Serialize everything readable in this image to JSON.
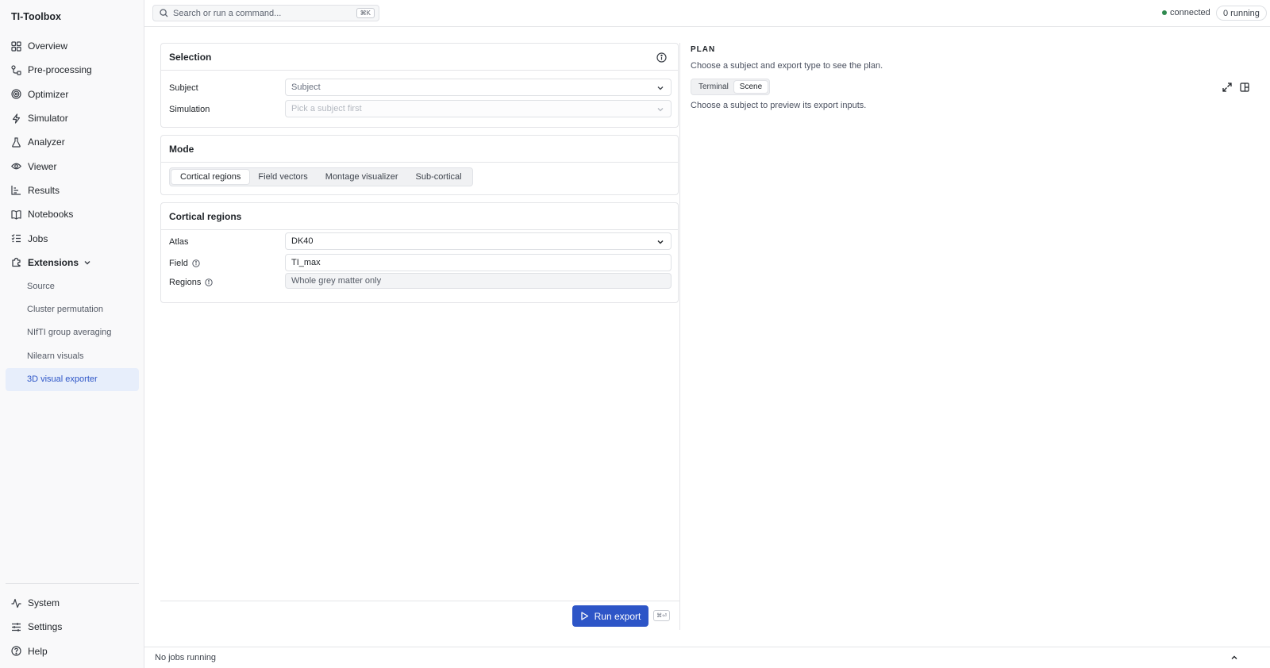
{
  "app": {
    "title": "TI-Toolbox"
  },
  "sidebar": {
    "items": [
      {
        "label": "Overview",
        "icon": "grid-icon"
      },
      {
        "label": "Pre-processing",
        "icon": "workflow-icon"
      },
      {
        "label": "Optimizer",
        "icon": "target-icon"
      },
      {
        "label": "Simulator",
        "icon": "bolt-icon"
      },
      {
        "label": "Analyzer",
        "icon": "flask-icon"
      },
      {
        "label": "Viewer",
        "icon": "eye-icon"
      },
      {
        "label": "Results",
        "icon": "results-icon"
      },
      {
        "label": "Notebooks",
        "icon": "book-icon"
      },
      {
        "label": "Jobs",
        "icon": "list-check-icon"
      },
      {
        "label": "Extensions",
        "icon": "puzzle-icon",
        "expanded": true
      }
    ],
    "extensions": [
      {
        "label": "Source"
      },
      {
        "label": "Cluster permutation"
      },
      {
        "label": "NIfTI group averaging"
      },
      {
        "label": "Nilearn visuals"
      },
      {
        "label": "3D visual exporter",
        "active": true
      }
    ],
    "bottom": [
      {
        "label": "System",
        "icon": "activity-icon"
      },
      {
        "label": "Settings",
        "icon": "sliders-icon"
      },
      {
        "label": "Help",
        "icon": "help-icon"
      }
    ]
  },
  "topbar": {
    "search_placeholder": "Search or run a command...",
    "search_shortcut": "⌘K",
    "status_text": "connected",
    "running_text": "0 running",
    "status_color": "#2f8a4f"
  },
  "selection": {
    "title": "Selection",
    "subject_label": "Subject",
    "subject_placeholder": "Subject",
    "simulation_label": "Simulation",
    "simulation_placeholder": "Pick a subject first"
  },
  "mode": {
    "title": "Mode",
    "tabs": [
      {
        "label": "Cortical regions",
        "active": true
      },
      {
        "label": "Field vectors"
      },
      {
        "label": "Montage visualizer"
      },
      {
        "label": "Sub-cortical"
      }
    ]
  },
  "cortical": {
    "title": "Cortical regions",
    "atlas_label": "Atlas",
    "atlas_value": "DK40",
    "field_label": "Field",
    "field_value": "TI_max",
    "regions_label": "Regions",
    "regions_value": "Whole grey matter only"
  },
  "actions": {
    "run_label": "Run export",
    "run_shortcut": "⌘⏎",
    "accent_color": "#2d55c7"
  },
  "plan": {
    "title": "PLAN",
    "description": "Choose a subject and export type to see the plan.",
    "tabs": [
      {
        "label": "Terminal"
      },
      {
        "label": "Scene",
        "active": true
      }
    ],
    "hint": "Choose a subject to preview its export inputs."
  },
  "statusbar": {
    "text": "No jobs running"
  }
}
